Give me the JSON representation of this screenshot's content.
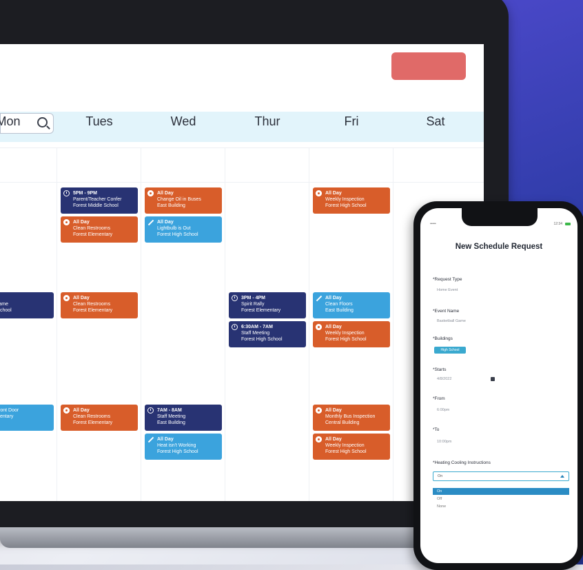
{
  "calendar": {
    "days": [
      "Mon",
      "Tues",
      "Wed",
      "Thur",
      "Fri",
      "Sat"
    ],
    "events": [
      {
        "col": "tues",
        "row": 1,
        "kind": "dark",
        "icon": "clock-icon",
        "time": "5PM - 9PM",
        "title": "Parent/Teacher Confer",
        "place": "Forest Middle School"
      },
      {
        "col": "tues",
        "row": 2,
        "kind": "orange",
        "icon": "gear-icon",
        "time": "All Day",
        "title": "Clean Restrooms",
        "place": "Forest Elementary"
      },
      {
        "col": "wed",
        "row": 1,
        "kind": "orange",
        "icon": "gear-icon",
        "time": "All Day",
        "title": "Change Oil in Buses",
        "place": "East Building"
      },
      {
        "col": "wed",
        "row": 2,
        "kind": "lblue",
        "icon": "wrench-icon",
        "time": "All Day",
        "title": "Lightbulb is Out",
        "place": "Forest High School"
      },
      {
        "col": "fri",
        "row": 1,
        "kind": "orange",
        "icon": "gear-icon",
        "time": "All Day",
        "title": "Weekly Inspection",
        "place": "Forest High School"
      },
      {
        "col": "mon",
        "row": 3,
        "kind": "dark",
        "icon": "clock-icon",
        "time": "PM",
        "title": "all Game",
        "place": "igh School"
      },
      {
        "col": "tues",
        "row": 3,
        "kind": "orange",
        "icon": "gear-icon",
        "time": "All Day",
        "title": "Clean Restrooms",
        "place": "Forest Elementary"
      },
      {
        "col": "thur",
        "row": 3,
        "kind": "dark",
        "icon": "clock-icon",
        "time": "3PM - 4PM",
        "title": "Spirit Rally",
        "place": "Forest Elementary"
      },
      {
        "col": "thur",
        "row": 4,
        "kind": "dark",
        "icon": "clock-icon",
        "time": "6:30AM - 7AM",
        "title": "Staff Meeting",
        "place": "Forest High School"
      },
      {
        "col": "fri",
        "row": 3,
        "kind": "lblue",
        "icon": "wrench-icon",
        "time": "All Day",
        "title": "Clean Floors",
        "place": "East Building"
      },
      {
        "col": "fri",
        "row": 4,
        "kind": "orange",
        "icon": "gear-icon",
        "time": "All Day",
        "title": "Weekly Inspection",
        "place": "Forest High School"
      },
      {
        "col": "mon",
        "row": 5,
        "kind": "lblue",
        "icon": "wrench-icon",
        "time": "",
        "title": "on Front Door",
        "place": "Elementary"
      },
      {
        "col": "tues",
        "row": 5,
        "kind": "orange",
        "icon": "gear-icon",
        "time": "All Day",
        "title": "Clean Restrooms",
        "place": "Forest Elementary"
      },
      {
        "col": "wed",
        "row": 5,
        "kind": "dark",
        "icon": "clock-icon",
        "time": "7AM - 8AM",
        "title": "Staff Meeting",
        "place": "East Building"
      },
      {
        "col": "wed",
        "row": 6,
        "kind": "lblue",
        "icon": "wrench-icon",
        "time": "All Day",
        "title": "Heat isn't Working",
        "place": "Forest High School"
      },
      {
        "col": "fri",
        "row": 5,
        "kind": "orange",
        "icon": "gear-icon",
        "time": "All Day",
        "title": "Monthly Bus Inspection",
        "place": "Central Building"
      },
      {
        "col": "fri",
        "row": 6,
        "kind": "orange",
        "icon": "gear-icon",
        "time": "All Day",
        "title": "Weekly Inspection",
        "place": "Forest High School"
      }
    ]
  },
  "phone": {
    "status_left": "•••••",
    "status_right": "12:34",
    "title": "New Schedule Request",
    "fields": {
      "request_type": {
        "label": "*Request Type",
        "value": "Home Event"
      },
      "event_name": {
        "label": "*Event Name",
        "value": "Basketball Game"
      },
      "buildings": {
        "label": "*Buildings",
        "value": "High School"
      },
      "starts": {
        "label": "*Starts",
        "value": "4/8/2022"
      },
      "from": {
        "label": "*From",
        "value": "6:00pm"
      },
      "to": {
        "label": "*To",
        "value": "10:00pm"
      },
      "heating": {
        "label": "*Heating Cooling Instructions",
        "value": "On",
        "options": [
          "On",
          "Off",
          "None"
        ]
      }
    }
  }
}
